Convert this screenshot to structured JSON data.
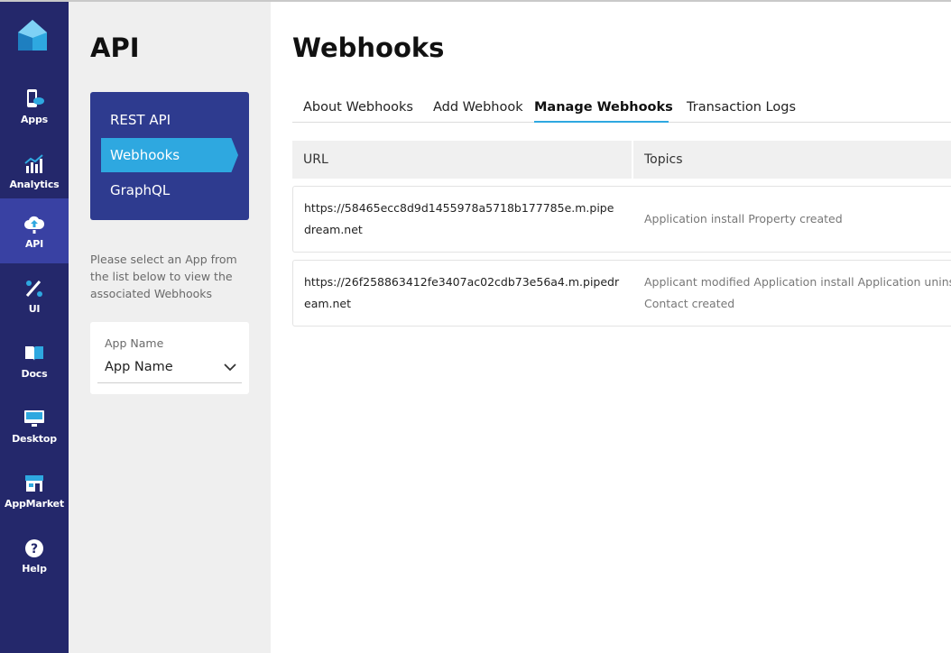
{
  "rail": {
    "items": [
      {
        "label": "Apps",
        "icon": "phone-cloud-icon"
      },
      {
        "label": "Analytics",
        "icon": "chart-icon"
      },
      {
        "label": "API",
        "icon": "cloud-upload-icon",
        "active": true
      },
      {
        "label": "UI",
        "icon": "brush-icon"
      },
      {
        "label": "Docs",
        "icon": "book-icon"
      },
      {
        "label": "Desktop",
        "icon": "monitor-icon"
      },
      {
        "label": "AppMarket",
        "icon": "store-icon"
      },
      {
        "label": "Help",
        "icon": "help-icon"
      }
    ],
    "background": "#24286b",
    "active_background": "#3941a3"
  },
  "subpanel": {
    "title": "API",
    "nav": [
      {
        "label": "REST API"
      },
      {
        "label": "Webhooks",
        "active": true
      },
      {
        "label": "GraphQL"
      }
    ],
    "hint": "Please select an App from the list below to view the associated Webhooks",
    "app_select": {
      "label": "App Name",
      "value": "App Name"
    }
  },
  "main": {
    "title": "Webhooks",
    "tabs": [
      {
        "label": "About Webhooks"
      },
      {
        "label": "Add Webhook"
      },
      {
        "label": "Manage Webhooks",
        "active": true
      },
      {
        "label": "Transaction Logs"
      }
    ],
    "table": {
      "columns": [
        "URL",
        "Topics"
      ],
      "rows": [
        {
          "url": "https://58465ecc8d9d1455978a5718b177785e.m.pipedream.net",
          "topics_line1": "Application install Property created",
          "topics_line2": ""
        },
        {
          "url": "https://26f258863412fe3407ac02cdb73e56a4.m.pipedream.net",
          "topics_line1": "Applicant modified Application install Application uninstall",
          "topics_line2": "Contact created"
        }
      ]
    }
  },
  "colors": {
    "accent": "#2ea8e0",
    "nav_panel": "#2e3b8f"
  }
}
